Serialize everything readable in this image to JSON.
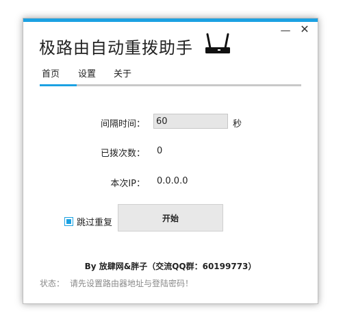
{
  "window": {
    "minimize_glyph": "—",
    "close_glyph": "✕",
    "accent_color": "#1ba1e2"
  },
  "app": {
    "title": "极路由自动重拨助手",
    "logo_icon": "router-icon"
  },
  "tabs": [
    {
      "label": "首页",
      "active": true
    },
    {
      "label": "设置",
      "active": false
    },
    {
      "label": "关于",
      "active": false
    }
  ],
  "home": {
    "interval_label": "间隔时间：",
    "interval_value": "60",
    "interval_unit": "秒",
    "redial_count_label": "已拨次数：",
    "redial_count_value": "0",
    "ip_label": "本次IP：",
    "ip_value": "0.0.0.0",
    "skip_duplicate_label": "跳过重复",
    "skip_duplicate_checked": true,
    "start_button_label": "开始"
  },
  "footer": {
    "credit": "By 放肆网&胖子（交流QQ群：60199773）",
    "status_label": "状态：",
    "status_text": "请先设置路由器地址与登陆密码！"
  }
}
